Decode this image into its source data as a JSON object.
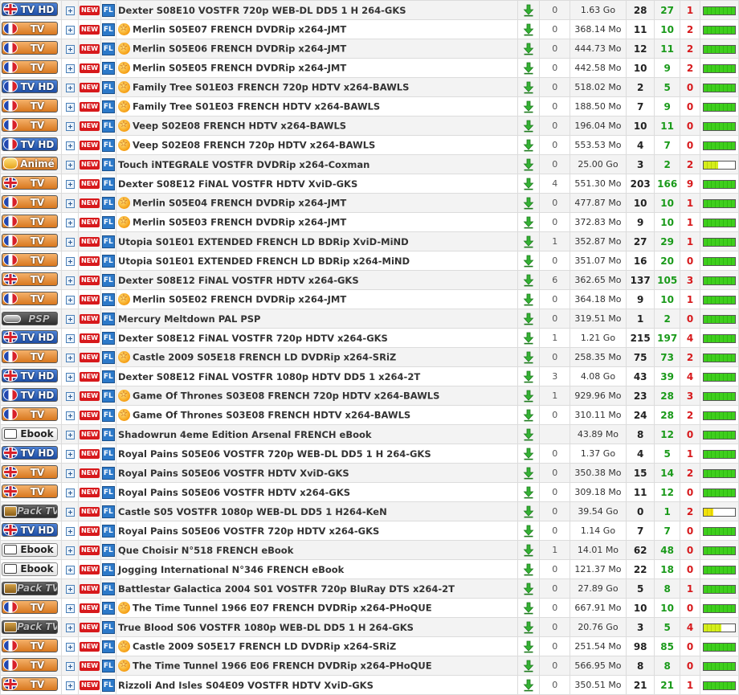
{
  "new_label": "NEW",
  "fl_label": "FL",
  "rows": [
    {
      "cat": "TV HD",
      "flag": "uk",
      "star": false,
      "name": "Dexter S08E10 VOSTFR 720p WEB-DL DD5 1 H 264-GKS",
      "comments": "0",
      "size": "1.63 Go",
      "seeders": "28",
      "leechers": "27",
      "completed": "1",
      "progress": 1.0
    },
    {
      "cat": "TV",
      "flag": "fr",
      "star": true,
      "name": "Merlin S05E07 FRENCH DVDRip x264-JMT",
      "comments": "0",
      "size": "368.14 Mo",
      "seeders": "11",
      "leechers": "10",
      "completed": "2",
      "progress": 1.0
    },
    {
      "cat": "TV",
      "flag": "fr",
      "star": true,
      "name": "Merlin S05E06 FRENCH DVDRip x264-JMT",
      "comments": "0",
      "size": "444.73 Mo",
      "seeders": "12",
      "leechers": "11",
      "completed": "2",
      "progress": 1.0
    },
    {
      "cat": "TV",
      "flag": "fr",
      "star": true,
      "name": "Merlin S05E05 FRENCH DVDRip x264-JMT",
      "comments": "0",
      "size": "442.58 Mo",
      "seeders": "10",
      "leechers": "9",
      "completed": "2",
      "progress": 1.0
    },
    {
      "cat": "TV HD",
      "flag": "fr",
      "star": true,
      "name": "Family Tree S01E03 FRENCH 720p HDTV x264-BAWLS",
      "comments": "0",
      "size": "518.02 Mo",
      "seeders": "2",
      "leechers": "5",
      "completed": "0",
      "progress": 1.0
    },
    {
      "cat": "TV",
      "flag": "fr",
      "star": true,
      "name": "Family Tree S01E03 FRENCH HDTV x264-BAWLS",
      "comments": "0",
      "size": "188.50 Mo",
      "seeders": "7",
      "leechers": "9",
      "completed": "0",
      "progress": 1.0
    },
    {
      "cat": "TV",
      "flag": "fr",
      "star": true,
      "name": "Veep S02E08 FRENCH HDTV x264-BAWLS",
      "comments": "0",
      "size": "196.04 Mo",
      "seeders": "10",
      "leechers": "11",
      "completed": "0",
      "progress": 1.0
    },
    {
      "cat": "TV HD",
      "flag": "fr",
      "star": true,
      "name": "Veep S02E08 FRENCH 720p HDTV x264-BAWLS",
      "comments": "0",
      "size": "553.53 Mo",
      "seeders": "4",
      "leechers": "7",
      "completed": "0",
      "progress": 1.0
    },
    {
      "cat": "Animé",
      "flag": "none",
      "star": false,
      "name": "Touch iNTEGRALE VOSTFR DVDRip x264-Coxman",
      "comments": "0",
      "size": "25.00 Go",
      "seeders": "3",
      "leechers": "2",
      "completed": "2",
      "progress": 0.45
    },
    {
      "cat": "TV",
      "flag": "uk",
      "star": false,
      "name": "Dexter S08E12 FiNAL VOSTFR HDTV XviD-GKS",
      "comments": "4",
      "size": "551.30 Mo",
      "seeders": "203",
      "leechers": "166",
      "completed": "9",
      "progress": 1.0
    },
    {
      "cat": "TV",
      "flag": "fr",
      "star": true,
      "name": "Merlin S05E04 FRENCH DVDRip x264-JMT",
      "comments": "0",
      "size": "477.87 Mo",
      "seeders": "10",
      "leechers": "10",
      "completed": "1",
      "progress": 1.0
    },
    {
      "cat": "TV",
      "flag": "fr",
      "star": true,
      "name": "Merlin S05E03 FRENCH DVDRip x264-JMT",
      "comments": "0",
      "size": "372.83 Mo",
      "seeders": "9",
      "leechers": "10",
      "completed": "1",
      "progress": 1.0
    },
    {
      "cat": "TV",
      "flag": "fr",
      "star": false,
      "name": "Utopia S01E01 EXTENDED FRENCH LD BDRip XviD-MiND",
      "comments": "1",
      "size": "352.87 Mo",
      "seeders": "27",
      "leechers": "29",
      "completed": "1",
      "progress": 1.0
    },
    {
      "cat": "TV",
      "flag": "fr",
      "star": false,
      "name": "Utopia S01E01 EXTENDED FRENCH LD BDRip x264-MiND",
      "comments": "0",
      "size": "351.07 Mo",
      "seeders": "16",
      "leechers": "20",
      "completed": "0",
      "progress": 1.0
    },
    {
      "cat": "TV",
      "flag": "uk",
      "star": false,
      "name": "Dexter S08E12 FiNAL VOSTFR HDTV x264-GKS",
      "comments": "6",
      "size": "362.65 Mo",
      "seeders": "137",
      "leechers": "105",
      "completed": "3",
      "progress": 1.0
    },
    {
      "cat": "TV",
      "flag": "fr",
      "star": true,
      "name": "Merlin S05E02 FRENCH DVDRip x264-JMT",
      "comments": "0",
      "size": "364.18 Mo",
      "seeders": "9",
      "leechers": "10",
      "completed": "1",
      "progress": 1.0
    },
    {
      "cat": "PSP",
      "flag": "psp",
      "star": false,
      "name": "Mercury Meltdown PAL PSP",
      "comments": "0",
      "size": "319.51 Mo",
      "seeders": "1",
      "leechers": "2",
      "completed": "0",
      "progress": 1.0
    },
    {
      "cat": "TV HD",
      "flag": "uk",
      "star": false,
      "name": "Dexter S08E12 FiNAL VOSTFR 720p HDTV x264-GKS",
      "comments": "1",
      "size": "1.21 Go",
      "seeders": "215",
      "leechers": "197",
      "completed": "4",
      "progress": 1.0
    },
    {
      "cat": "TV",
      "flag": "fr",
      "star": true,
      "name": "Castle 2009 S05E18 FRENCH LD DVDRip x264-SRiZ",
      "comments": "0",
      "size": "258.35 Mo",
      "seeders": "75",
      "leechers": "73",
      "completed": "2",
      "progress": 1.0
    },
    {
      "cat": "TV HD",
      "flag": "uk",
      "star": false,
      "name": "Dexter S08E12 FiNAL VOSTFR 1080p HDTV DD5 1 x264-2T",
      "comments": "3",
      "size": "4.08 Go",
      "seeders": "43",
      "leechers": "39",
      "completed": "4",
      "progress": 1.0
    },
    {
      "cat": "TV HD",
      "flag": "fr",
      "star": true,
      "name": "Game Of Thrones S03E08 FRENCH 720p HDTV x264-BAWLS",
      "comments": "1",
      "size": "929.96 Mo",
      "seeders": "23",
      "leechers": "28",
      "completed": "3",
      "progress": 1.0
    },
    {
      "cat": "TV",
      "flag": "fr",
      "star": true,
      "name": "Game Of Thrones S03E08 FRENCH HDTV x264-BAWLS",
      "comments": "0",
      "size": "310.11 Mo",
      "seeders": "24",
      "leechers": "28",
      "completed": "2",
      "progress": 1.0
    },
    {
      "cat": "Ebook",
      "flag": "book",
      "star": false,
      "name": "Shadowrun 4eme Edition Arsenal FRENCH eBook",
      "comments": "",
      "size": "43.89 Mo",
      "seeders": "8",
      "leechers": "12",
      "completed": "0",
      "progress": 1.0
    },
    {
      "cat": "TV HD",
      "flag": "uk",
      "star": false,
      "name": "Royal Pains S05E06 VOSTFR 720p WEB-DL DD5 1 H 264-GKS",
      "comments": "0",
      "size": "1.37 Go",
      "seeders": "4",
      "leechers": "5",
      "completed": "1",
      "progress": 1.0
    },
    {
      "cat": "TV",
      "flag": "uk",
      "star": false,
      "name": "Royal Pains S05E06 VOSTFR HDTV XviD-GKS",
      "comments": "0",
      "size": "350.38 Mo",
      "seeders": "15",
      "leechers": "14",
      "completed": "2",
      "progress": 1.0
    },
    {
      "cat": "TV",
      "flag": "uk",
      "star": false,
      "name": "Royal Pains S05E06 VOSTFR HDTV x264-GKS",
      "comments": "0",
      "size": "309.18 Mo",
      "seeders": "11",
      "leechers": "12",
      "completed": "0",
      "progress": 1.0
    },
    {
      "cat": "Pack TV",
      "flag": "pack",
      "star": false,
      "name": "Castle S05 VOSTFR 1080p WEB-DL DD5 1 H264-KeN",
      "comments": "0",
      "size": "39.54 Go",
      "seeders": "0",
      "leechers": "1",
      "completed": "2",
      "progress": 0.3
    },
    {
      "cat": "TV HD",
      "flag": "uk",
      "star": false,
      "name": "Royal Pains S05E06 VOSTFR 720p HDTV x264-GKS",
      "comments": "0",
      "size": "1.14 Go",
      "seeders": "7",
      "leechers": "7",
      "completed": "0",
      "progress": 1.0
    },
    {
      "cat": "Ebook",
      "flag": "book",
      "star": false,
      "name": "Que Choisir N°518 FRENCH eBook",
      "comments": "1",
      "size": "14.01 Mo",
      "seeders": "62",
      "leechers": "48",
      "completed": "0",
      "progress": 1.0
    },
    {
      "cat": "Ebook",
      "flag": "book",
      "star": false,
      "name": "Jogging International N°346 FRENCH eBook",
      "comments": "0",
      "size": "121.37 Mo",
      "seeders": "22",
      "leechers": "18",
      "completed": "0",
      "progress": 1.0
    },
    {
      "cat": "Pack TV",
      "flag": "pack",
      "star": false,
      "name": "Battlestar Galactica 2004 S01 VOSTFR 720p BluRay DTS x264-2T",
      "comments": "0",
      "size": "27.89 Go",
      "seeders": "5",
      "leechers": "8",
      "completed": "1",
      "progress": 1.0
    },
    {
      "cat": "TV",
      "flag": "fr",
      "star": true,
      "name": "The Time Tunnel 1966 E07 FRENCH DVDRip x264-PHoQUE",
      "comments": "0",
      "size": "667.91 Mo",
      "seeders": "10",
      "leechers": "10",
      "completed": "0",
      "progress": 1.0
    },
    {
      "cat": "Pack TV",
      "flag": "pack",
      "star": false,
      "name": "True Blood S06 VOSTFR 1080p WEB-DL DD5 1 H 264-GKS",
      "comments": "0",
      "size": "20.76 Go",
      "seeders": "3",
      "leechers": "5",
      "completed": "4",
      "progress": 0.55
    },
    {
      "cat": "TV",
      "flag": "fr",
      "star": true,
      "name": "Castle 2009 S05E17 FRENCH LD DVDRip x264-SRiZ",
      "comments": "0",
      "size": "251.54 Mo",
      "seeders": "98",
      "leechers": "85",
      "completed": "0",
      "progress": 1.0
    },
    {
      "cat": "TV",
      "flag": "fr",
      "star": true,
      "name": "The Time Tunnel 1966 E06 FRENCH DVDRip x264-PHoQUE",
      "comments": "0",
      "size": "566.95 Mo",
      "seeders": "8",
      "leechers": "8",
      "completed": "0",
      "progress": 1.0
    },
    {
      "cat": "TV",
      "flag": "uk",
      "star": false,
      "name": "Rizzoli And Isles S04E09 VOSTFR HDTV XviD-GKS",
      "comments": "0",
      "size": "350.51 Mo",
      "seeders": "21",
      "leechers": "21",
      "completed": "1",
      "progress": 1.0
    }
  ],
  "colors": {
    "completed_red": "#d7191c",
    "completed_zero": "#d7191c",
    "leechers_green": "#1a9a1a"
  }
}
